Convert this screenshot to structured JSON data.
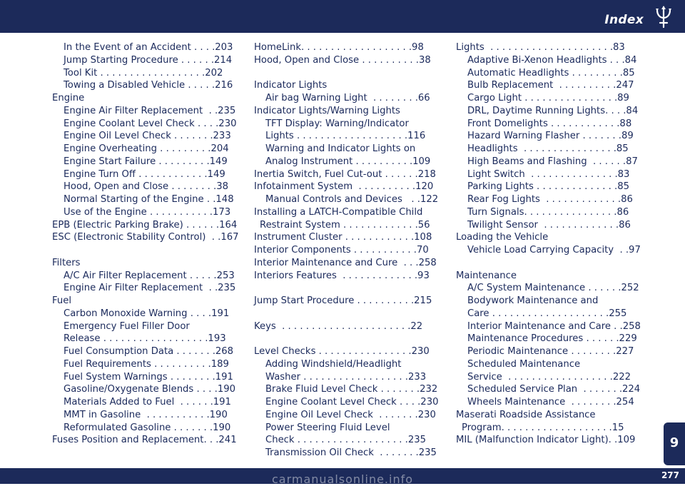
{
  "header": {
    "title": "Index"
  },
  "chapter_tab": "9",
  "page_number": "277",
  "watermark": "carmanualsonline.info",
  "columns": [
    [
      {
        "t": "In the Event of an Accident . . . .203",
        "lv": 1
      },
      {
        "t": "Jump Starting Procedure . . . . . .214",
        "lv": 1
      },
      {
        "t": "Tool Kit . . . . . . . . . . . . . . . . . .202",
        "lv": 1
      },
      {
        "t": "Towing a Disabled Vehicle . . . . .216",
        "lv": 1
      },
      {
        "t": "Engine",
        "lv": 0
      },
      {
        "t": "Engine Air Filter Replacement  . .235",
        "lv": 1
      },
      {
        "t": "Engine Coolant Level Check . . . .230",
        "lv": 1
      },
      {
        "t": "Engine Oil Level Check . . . . . . .233",
        "lv": 1
      },
      {
        "t": "Engine Overheating . . . . . . . . .204",
        "lv": 1
      },
      {
        "t": "Engine Start Failure . . . . . . . . .149",
        "lv": 1
      },
      {
        "t": "Engine Turn Off . . . . . . . . . . . .149",
        "lv": 1
      },
      {
        "t": "Hood, Open and Close . . . . . . . .38",
        "lv": 1
      },
      {
        "t": "Normal Starting of the Engine . .148",
        "lv": 1
      },
      {
        "t": "Use of the Engine . . . . . . . . . . .173",
        "lv": 1
      },
      {
        "t": "EPB (Electric Parking Brake) . . . . . .164",
        "lv": 0
      },
      {
        "t": "ESC (Electronic Stability Control)  . .167",
        "lv": 0
      },
      {
        "t": "",
        "lv": 0
      },
      {
        "t": "Filters",
        "lv": 0
      },
      {
        "t": "A/C Air Filter Replacement . . . . .253",
        "lv": 1
      },
      {
        "t": "Engine Air Filter Replacement  . .235",
        "lv": 1
      },
      {
        "t": "Fuel",
        "lv": 0
      },
      {
        "t": "Carbon Monoxide Warning . . . .191",
        "lv": 1
      },
      {
        "t": "Emergency Fuel Filler Door",
        "lv": 1
      },
      {
        "t": "Release . . . . . . . . . . . . . . . . . .193",
        "lv": 1
      },
      {
        "t": "Fuel Consumption Data . . . . . . .268",
        "lv": 1
      },
      {
        "t": "Fuel Requirements . . . . . . . . . .189",
        "lv": 1
      },
      {
        "t": "Fuel System Warnings . . . . . . . .191",
        "lv": 1
      },
      {
        "t": "Gasoline/Oxygenate Blends . . . .190",
        "lv": 1
      },
      {
        "t": "Materials Added to Fuel  . . . . . .191",
        "lv": 1
      },
      {
        "t": "MMT in Gasoline  . . . . . . . . . . .190",
        "lv": 1
      },
      {
        "t": "Reformulated Gasoline . . . . . . .190",
        "lv": 1
      },
      {
        "t": "Fuses Position and Replacement. . .241",
        "lv": 0
      }
    ],
    [
      {
        "t": "HomeLink. . . . . . . . . . . . . . . . . . .98",
        "lv": 0
      },
      {
        "t": "Hood, Open and Close . . . . . . . . . .38",
        "lv": 0
      },
      {
        "t": "",
        "lv": 0
      },
      {
        "t": "Indicator Lights",
        "lv": 0
      },
      {
        "t": "Air bag Warning Light  . . . . . . . .66",
        "lv": 1
      },
      {
        "t": "Indicator Lights/Warning Lights",
        "lv": 0
      },
      {
        "t": "TFT Display: Warning/Indicator",
        "lv": 1
      },
      {
        "t": "Lights . . . . . . . . . . . . . . . . . . .116",
        "lv": 1
      },
      {
        "t": "Warning and Indicator Lights on",
        "lv": 1
      },
      {
        "t": "Analog Instrument . . . . . . . . . .109",
        "lv": 1
      },
      {
        "t": "Inertia Switch, Fuel Cut-out . . . . . .218",
        "lv": 0
      },
      {
        "t": "Infotainment System  . . . . . . . . . .120",
        "lv": 0
      },
      {
        "t": "Manual Controls and Devices   . .122",
        "lv": 1
      },
      {
        "t": "Installing a LATCH-Compatible Child",
        "lv": 0
      },
      {
        "t": "Restraint System . . . . . . . . . . . . .56",
        "lv": 2
      },
      {
        "t": "Instrument Cluster . . . . . . . . . . . .108",
        "lv": 0
      },
      {
        "t": "Interior Components . . . . . . . . . . .70",
        "lv": 0
      },
      {
        "t": "Interior Maintenance and Cure  . . .258",
        "lv": 0
      },
      {
        "t": "Interiors Features  . . . . . . . . . . . . .93",
        "lv": 0
      },
      {
        "t": "",
        "lv": 0
      },
      {
        "t": "Jump Start Procedure . . . . . . . . . .215",
        "lv": 0
      },
      {
        "t": "",
        "lv": 0
      },
      {
        "t": "Keys  . . . . . . . . . . . . . . . . . . . . . .22",
        "lv": 0
      },
      {
        "t": "",
        "lv": 0
      },
      {
        "t": "Level Checks . . . . . . . . . . . . . . . .230",
        "lv": 0
      },
      {
        "t": "Adding Windshield/Headlight",
        "lv": 1
      },
      {
        "t": "Washer . . . . . . . . . . . . . . . . . .233",
        "lv": 1
      },
      {
        "t": "Brake Fluid Level Check . . . . . . .232",
        "lv": 1
      },
      {
        "t": "Engine Coolant Level Check . . . .230",
        "lv": 1
      },
      {
        "t": "Engine Oil Level Check  . . . . . . .230",
        "lv": 1
      },
      {
        "t": "Power Steering Fluid Level",
        "lv": 1
      },
      {
        "t": "Check . . . . . . . . . . . . . . . . . . .235",
        "lv": 1
      },
      {
        "t": "Transmission Oil Check  . . . . . . .235",
        "lv": 1
      }
    ],
    [
      {
        "t": "Lights  . . . . . . . . . . . . . . . . . . . . .83",
        "lv": 0
      },
      {
        "t": "Adaptive Bi-Xenon Headlights . . .84",
        "lv": 1
      },
      {
        "t": "Automatic Headlights . . . . . . . . .85",
        "lv": 1
      },
      {
        "t": "Bulb Replacement  . . . . . . . . . .247",
        "lv": 1
      },
      {
        "t": "Cargo Light . . . . . . . . . . . . . . . .89",
        "lv": 1
      },
      {
        "t": "DRL, Daytime Running Lights. . . .84",
        "lv": 1
      },
      {
        "t": "Front Domelights . . . . . . . . . . . .88",
        "lv": 1
      },
      {
        "t": "Hazard Warning Flasher . . . . . . .89",
        "lv": 1
      },
      {
        "t": "Headlights  . . . . . . . . . . . . . . . .85",
        "lv": 1
      },
      {
        "t": "High Beams and Flashing  . . . . . .87",
        "lv": 1
      },
      {
        "t": "Light Switch  . . . . . . . . . . . . . . .83",
        "lv": 1
      },
      {
        "t": "Parking Lights . . . . . . . . . . . . . .85",
        "lv": 1
      },
      {
        "t": "Rear Fog Lights  . . . . . . . . . . . . .86",
        "lv": 1
      },
      {
        "t": "Turn Signals. . . . . . . . . . . . . . . .86",
        "lv": 1
      },
      {
        "t": "Twilight Sensor  . . . . . . . . . . . . .86",
        "lv": 1
      },
      {
        "t": "Loading the Vehicle",
        "lv": 0
      },
      {
        "t": "Vehicle Load Carrying Capacity  . .97",
        "lv": 1
      },
      {
        "t": "",
        "lv": 0
      },
      {
        "t": "Maintenance",
        "lv": 0
      },
      {
        "t": "A/C System Maintenance . . . . . .252",
        "lv": 1
      },
      {
        "t": "Bodywork Maintenance and",
        "lv": 1
      },
      {
        "t": "Care . . . . . . . . . . . . . . . . . . . .255",
        "lv": 1
      },
      {
        "t": "Interior Maintenance and Care . .258",
        "lv": 1
      },
      {
        "t": "Maintenance Procedures . . . . . .229",
        "lv": 1
      },
      {
        "t": "Periodic Maintenance . . . . . . . .227",
        "lv": 1
      },
      {
        "t": "Scheduled Maintenance",
        "lv": 1
      },
      {
        "t": "Service  . . . . . . . . . . . . . . . . . .222",
        "lv": 1
      },
      {
        "t": "Scheduled Service Plan  . . . . . . .224",
        "lv": 1
      },
      {
        "t": "Wheels Maintenance  . . . . . . . .254",
        "lv": 1
      },
      {
        "t": "Maserati Roadside Assistance",
        "lv": 0
      },
      {
        "t": "Program. . . . . . . . . . . . . . . . . . .15",
        "lv": 2
      },
      {
        "t": "MIL (Malfunction Indicator Light). .109",
        "lv": 0
      }
    ]
  ]
}
